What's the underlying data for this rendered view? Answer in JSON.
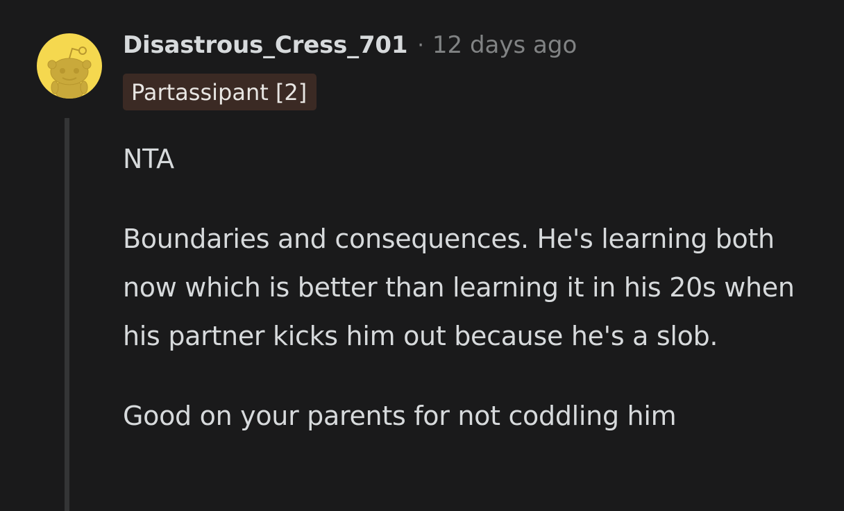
{
  "comment": {
    "avatar_icon": "reddit-snoo-avatar-icon",
    "avatar_color": "#f5d84f",
    "username": "Disastrous_Cress_701",
    "separator": "·",
    "timestamp": "12 days ago",
    "flair": "Partassipant [2]",
    "flair_color": "#3b2a24",
    "body": [
      "NTA",
      "Boundaries and consequences. He's learning both now which is better than learning it in his 20s when his partner kicks him out because he's a slob.",
      "Good on your parents for not coddling him"
    ]
  }
}
